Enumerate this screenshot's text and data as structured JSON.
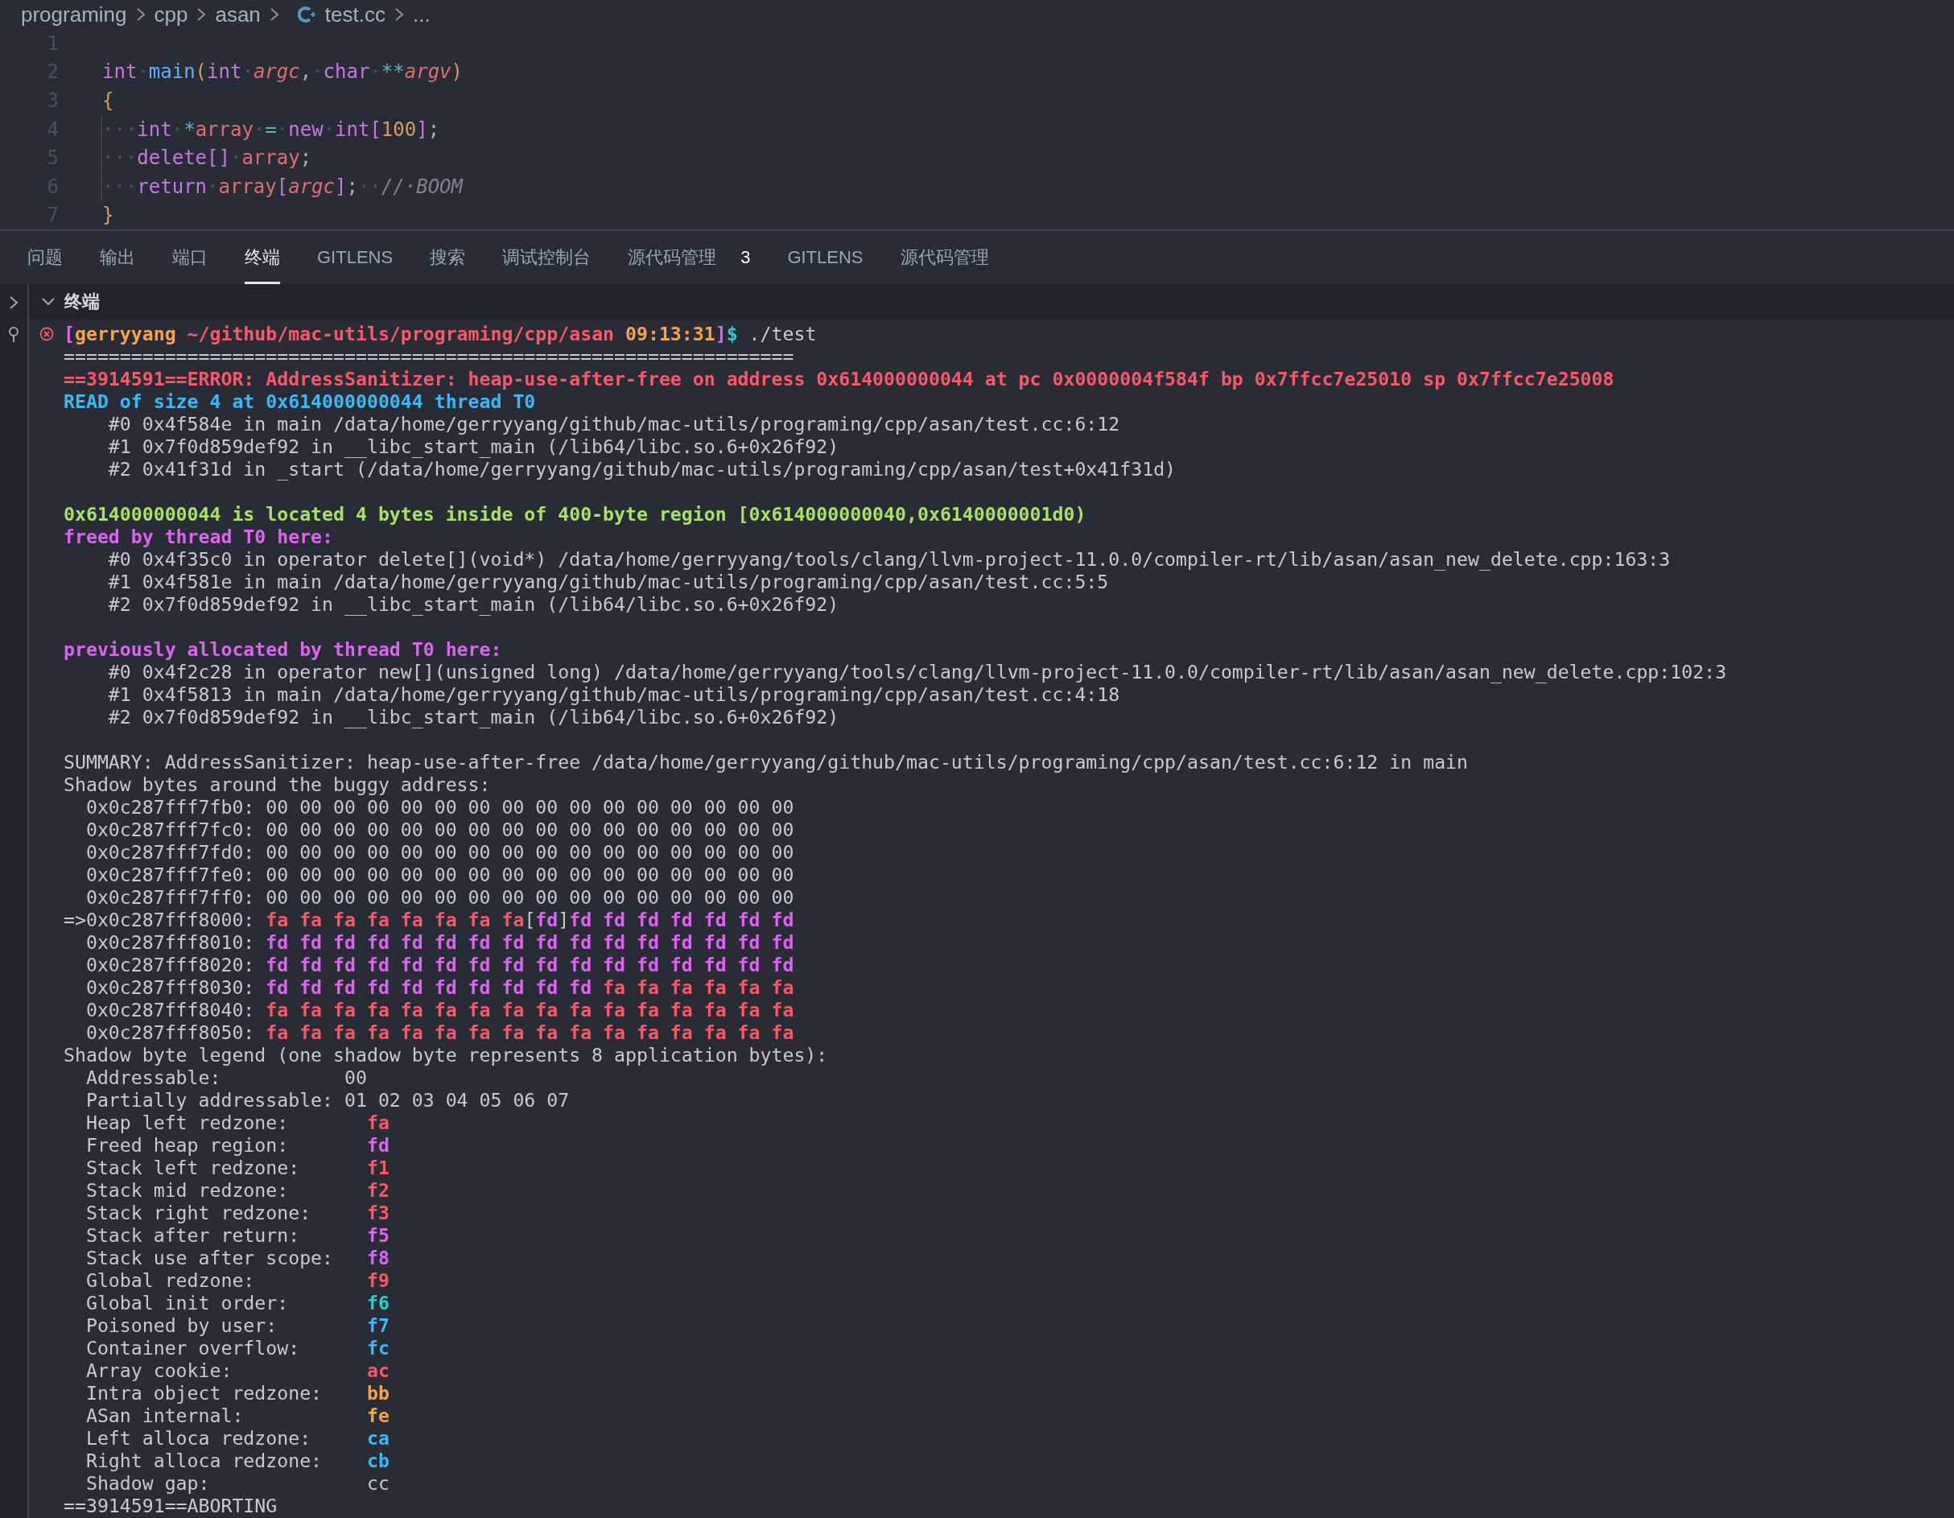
{
  "breadcrumb": [
    {
      "label": "programing",
      "kind": "folder"
    },
    {
      "label": "cpp",
      "kind": "folder"
    },
    {
      "label": "asan",
      "kind": "folder"
    },
    {
      "label": "test.cc",
      "kind": "cpp_file"
    },
    {
      "label": "...",
      "kind": "more"
    }
  ],
  "editor": {
    "lines": [
      {
        "number": "1",
        "indent_guide": false
      },
      {
        "number": "2",
        "indent_guide": false,
        "tokens": [
          {
            "text": "int",
            "kind": "keyword"
          },
          {
            "text": "·",
            "kind": "ws"
          },
          {
            "text": "main",
            "kind": "function"
          },
          {
            "text": "(",
            "kind": "brace"
          },
          {
            "text": "int",
            "kind": "keyword"
          },
          {
            "text": "·",
            "kind": "ws"
          },
          {
            "text": "argc",
            "kind": "param"
          },
          {
            "text": ",",
            "kind": "punct"
          },
          {
            "text": "·",
            "kind": "ws"
          },
          {
            "text": "char",
            "kind": "keyword"
          },
          {
            "text": "·",
            "kind": "ws"
          },
          {
            "text": "**",
            "kind": "operator"
          },
          {
            "text": "argv",
            "kind": "param"
          },
          {
            "text": ")",
            "kind": "brace"
          }
        ]
      },
      {
        "number": "3",
        "indent_guide": false,
        "tokens": [
          {
            "text": "{",
            "kind": "brace"
          }
        ]
      },
      {
        "number": "4",
        "indent_guide": true,
        "tokens": [
          {
            "text": "···",
            "kind": "ws"
          },
          {
            "text": "int",
            "kind": "keyword"
          },
          {
            "text": "·",
            "kind": "ws"
          },
          {
            "text": "*",
            "kind": "operator"
          },
          {
            "text": "array",
            "kind": "variable"
          },
          {
            "text": "·",
            "kind": "ws"
          },
          {
            "text": "=",
            "kind": "operator"
          },
          {
            "text": "·",
            "kind": "ws"
          },
          {
            "text": "new",
            "kind": "keyword"
          },
          {
            "text": "·",
            "kind": "ws"
          },
          {
            "text": "int",
            "kind": "keyword"
          },
          {
            "text": "[",
            "kind": "keyword"
          },
          {
            "text": "100",
            "kind": "number"
          },
          {
            "text": "]",
            "kind": "keyword"
          },
          {
            "text": ";",
            "kind": "punct"
          }
        ]
      },
      {
        "number": "5",
        "indent_guide": true,
        "tokens": [
          {
            "text": "···",
            "kind": "ws"
          },
          {
            "text": "delete[]",
            "kind": "keyword"
          },
          {
            "text": "·",
            "kind": "ws"
          },
          {
            "text": "array",
            "kind": "variable"
          },
          {
            "text": ";",
            "kind": "punct"
          }
        ]
      },
      {
        "number": "6",
        "indent_guide": true,
        "tokens": [
          {
            "text": "···",
            "kind": "ws"
          },
          {
            "text": "return",
            "kind": "keyword"
          },
          {
            "text": "·",
            "kind": "ws"
          },
          {
            "text": "array",
            "kind": "variable"
          },
          {
            "text": "[",
            "kind": "keyword"
          },
          {
            "text": "argc",
            "kind": "param"
          },
          {
            "text": "]",
            "kind": "keyword"
          },
          {
            "text": ";",
            "kind": "punct"
          },
          {
            "text": "··",
            "kind": "ws"
          },
          {
            "text": "//·BOOM",
            "kind": "comment"
          }
        ]
      },
      {
        "number": "7",
        "indent_guide": false,
        "tokens": [
          {
            "text": "}",
            "kind": "brace"
          }
        ]
      }
    ]
  },
  "tabs": [
    {
      "label": "问题",
      "selected": false
    },
    {
      "label": "输出",
      "selected": false
    },
    {
      "label": "端口",
      "selected": false
    },
    {
      "label": "终端",
      "selected": true
    },
    {
      "label": "GITLENS",
      "selected": false
    },
    {
      "label": "搜索",
      "selected": false
    },
    {
      "label": "调试控制台",
      "selected": false
    },
    {
      "label": "源代码管理",
      "selected": false,
      "badge": "3"
    },
    {
      "label": "GITLENS",
      "selected": false
    },
    {
      "label": "源代码管理",
      "selected": false
    }
  ],
  "terminal": {
    "title": "终端",
    "lines": [
      {
        "kind": "command",
        "segments": [
          {
            "text": "[",
            "kind": "magenta"
          },
          {
            "text": "gerryyang",
            "kind": "orange"
          },
          {
            "text": " ~/github/mac-utils/programing/cpp/asan ",
            "kind": "red"
          },
          {
            "text": "09:13:31",
            "kind": "orange"
          },
          {
            "text": "]",
            "kind": "magenta"
          },
          {
            "text": "$",
            "kind": "cyan"
          },
          {
            "text": " ./test",
            "kind": "plain"
          }
        ]
      },
      {
        "kind": "text",
        "segments": [
          {
            "text": "=================================================================",
            "kind": "plain"
          }
        ]
      },
      {
        "kind": "text",
        "segments": [
          {
            "text": "==3914591==ERROR: AddressSanitizer: heap-use-after-free on address 0x614000000044 at pc 0x0000004f584f bp 0x7ffcc7e25010 sp 0x7ffcc7e25008",
            "kind": "red"
          }
        ]
      },
      {
        "kind": "text",
        "segments": [
          {
            "text": "READ of size 4 at 0x614000000044 thread T0",
            "kind": "blue"
          }
        ]
      },
      {
        "kind": "text",
        "segments": [
          {
            "text": "    #0 0x4f584e in main /data/home/gerryyang/github/mac-utils/programing/cpp/asan/test.cc:6:12",
            "kind": "plain"
          }
        ]
      },
      {
        "kind": "text",
        "segments": [
          {
            "text": "    #1 0x7f0d859def92 in __libc_start_main (/lib64/libc.so.6+0x26f92)",
            "kind": "plain"
          }
        ]
      },
      {
        "kind": "text",
        "segments": [
          {
            "text": "    #2 0x41f31d in _start (/data/home/gerryyang/github/mac-utils/programing/cpp/asan/test+0x41f31d)",
            "kind": "plain"
          }
        ]
      },
      {
        "kind": "blank"
      },
      {
        "kind": "text",
        "segments": [
          {
            "text": "0x614000000044 is located 4 bytes inside of 400-byte region [0x614000000040,0x6140000001d0)",
            "kind": "green"
          }
        ]
      },
      {
        "kind": "text",
        "segments": [
          {
            "text": "freed by thread T0 here:",
            "kind": "magenta"
          }
        ]
      },
      {
        "kind": "text",
        "segments": [
          {
            "text": "    #0 0x4f35c0 in operator delete[](void*) /data/home/gerryyang/tools/clang/llvm-project-11.0.0/compiler-rt/lib/asan/asan_new_delete.cpp:163:3",
            "kind": "plain"
          }
        ]
      },
      {
        "kind": "text",
        "segments": [
          {
            "text": "    #1 0x4f581e in main /data/home/gerryyang/github/mac-utils/programing/cpp/asan/test.cc:5:5",
            "kind": "plain"
          }
        ]
      },
      {
        "kind": "text",
        "segments": [
          {
            "text": "    #2 0x7f0d859def92 in __libc_start_main (/lib64/libc.so.6+0x26f92)",
            "kind": "plain"
          }
        ]
      },
      {
        "kind": "blank"
      },
      {
        "kind": "text",
        "segments": [
          {
            "text": "previously allocated by thread T0 here:",
            "kind": "magenta"
          }
        ]
      },
      {
        "kind": "text",
        "segments": [
          {
            "text": "    #0 0x4f2c28 in operator new[](unsigned long) /data/home/gerryyang/tools/clang/llvm-project-11.0.0/compiler-rt/lib/asan/asan_new_delete.cpp:102:3",
            "kind": "plain"
          }
        ]
      },
      {
        "kind": "text",
        "segments": [
          {
            "text": "    #1 0x4f5813 in main /data/home/gerryyang/github/mac-utils/programing/cpp/asan/test.cc:4:18",
            "kind": "plain"
          }
        ]
      },
      {
        "kind": "text",
        "segments": [
          {
            "text": "    #2 0x7f0d859def92 in __libc_start_main (/lib64/libc.so.6+0x26f92)",
            "kind": "plain"
          }
        ]
      },
      {
        "kind": "blank"
      },
      {
        "kind": "text",
        "segments": [
          {
            "text": "SUMMARY: AddressSanitizer: heap-use-after-free /data/home/gerryyang/github/mac-utils/programing/cpp/asan/test.cc:6:12 in main",
            "kind": "plain"
          }
        ]
      },
      {
        "kind": "text",
        "segments": [
          {
            "text": "Shadow bytes around the buggy address:",
            "kind": "plain"
          }
        ]
      },
      {
        "kind": "text",
        "segments": [
          {
            "text": "  0x0c287fff7fb0: 00 00 00 00 00 00 00 00 00 00 00 00 00 00 00 00",
            "kind": "plain"
          }
        ]
      },
      {
        "kind": "text",
        "segments": [
          {
            "text": "  0x0c287fff7fc0: 00 00 00 00 00 00 00 00 00 00 00 00 00 00 00 00",
            "kind": "plain"
          }
        ]
      },
      {
        "kind": "text",
        "segments": [
          {
            "text": "  0x0c287fff7fd0: 00 00 00 00 00 00 00 00 00 00 00 00 00 00 00 00",
            "kind": "plain"
          }
        ]
      },
      {
        "kind": "text",
        "segments": [
          {
            "text": "  0x0c287fff7fe0: 00 00 00 00 00 00 00 00 00 00 00 00 00 00 00 00",
            "kind": "plain"
          }
        ]
      },
      {
        "kind": "text",
        "segments": [
          {
            "text": "  0x0c287fff7ff0: 00 00 00 00 00 00 00 00 00 00 00 00 00 00 00 00",
            "kind": "plain"
          }
        ]
      },
      {
        "kind": "text",
        "segments": [
          {
            "text": "=>0x0c287fff8000: ",
            "kind": "plain"
          },
          {
            "text": "fa fa fa fa fa fa fa fa",
            "kind": "red"
          },
          {
            "text": "[",
            "kind": "plain"
          },
          {
            "text": "fd",
            "kind": "magenta"
          },
          {
            "text": "]",
            "kind": "plain"
          },
          {
            "text": "fd fd fd fd fd fd fd",
            "kind": "magenta"
          }
        ]
      },
      {
        "kind": "text",
        "segments": [
          {
            "text": "  0x0c287fff8010: ",
            "kind": "plain"
          },
          {
            "text": "fd fd fd fd fd fd fd fd fd fd fd fd fd fd fd fd",
            "kind": "magenta"
          }
        ]
      },
      {
        "kind": "text",
        "segments": [
          {
            "text": "  0x0c287fff8020: ",
            "kind": "plain"
          },
          {
            "text": "fd fd fd fd fd fd fd fd fd fd fd fd fd fd fd fd",
            "kind": "magenta"
          }
        ]
      },
      {
        "kind": "text",
        "segments": [
          {
            "text": "  0x0c287fff8030: ",
            "kind": "plain"
          },
          {
            "text": "fd fd fd fd fd fd fd fd fd fd ",
            "kind": "magenta"
          },
          {
            "text": "fa fa fa fa fa fa",
            "kind": "red"
          }
        ]
      },
      {
        "kind": "text",
        "segments": [
          {
            "text": "  0x0c287fff8040: ",
            "kind": "plain"
          },
          {
            "text": "fa fa fa fa fa fa fa fa fa fa fa fa fa fa fa fa",
            "kind": "red"
          }
        ]
      },
      {
        "kind": "text",
        "segments": [
          {
            "text": "  0x0c287fff8050: ",
            "kind": "plain"
          },
          {
            "text": "fa fa fa fa fa fa fa fa fa fa fa fa fa fa fa fa",
            "kind": "red"
          }
        ]
      },
      {
        "kind": "text",
        "segments": [
          {
            "text": "Shadow byte legend (one shadow byte represents 8 application bytes):",
            "kind": "plain"
          }
        ]
      },
      {
        "kind": "text",
        "segments": [
          {
            "text": "  Addressable:           00",
            "kind": "plain"
          }
        ]
      },
      {
        "kind": "text",
        "segments": [
          {
            "text": "  Partially addressable: 01 02 03 04 05 06 07",
            "kind": "plain"
          }
        ]
      },
      {
        "kind": "text",
        "segments": [
          {
            "text": "  Heap left redzone:       ",
            "kind": "plain"
          },
          {
            "text": "fa",
            "kind": "red"
          }
        ]
      },
      {
        "kind": "text",
        "segments": [
          {
            "text": "  Freed heap region:       ",
            "kind": "plain"
          },
          {
            "text": "fd",
            "kind": "magenta"
          }
        ]
      },
      {
        "kind": "text",
        "segments": [
          {
            "text": "  Stack left redzone:      ",
            "kind": "plain"
          },
          {
            "text": "f1",
            "kind": "red"
          }
        ]
      },
      {
        "kind": "text",
        "segments": [
          {
            "text": "  Stack mid redzone:       ",
            "kind": "plain"
          },
          {
            "text": "f2",
            "kind": "red"
          }
        ]
      },
      {
        "kind": "text",
        "segments": [
          {
            "text": "  Stack right redzone:     ",
            "kind": "plain"
          },
          {
            "text": "f3",
            "kind": "red"
          }
        ]
      },
      {
        "kind": "text",
        "segments": [
          {
            "text": "  Stack after return:      ",
            "kind": "plain"
          },
          {
            "text": "f5",
            "kind": "magenta"
          }
        ]
      },
      {
        "kind": "text",
        "segments": [
          {
            "text": "  Stack use after scope:   ",
            "kind": "plain"
          },
          {
            "text": "f8",
            "kind": "magenta"
          }
        ]
      },
      {
        "kind": "text",
        "segments": [
          {
            "text": "  Global redzone:          ",
            "kind": "plain"
          },
          {
            "text": "f9",
            "kind": "red"
          }
        ]
      },
      {
        "kind": "text",
        "segments": [
          {
            "text": "  Global init order:       ",
            "kind": "plain"
          },
          {
            "text": "f6",
            "kind": "cyan"
          }
        ]
      },
      {
        "kind": "text",
        "segments": [
          {
            "text": "  Poisoned by user:        ",
            "kind": "plain"
          },
          {
            "text": "f7",
            "kind": "blue"
          }
        ]
      },
      {
        "kind": "text",
        "segments": [
          {
            "text": "  Container overflow:      ",
            "kind": "plain"
          },
          {
            "text": "fc",
            "kind": "blue"
          }
        ]
      },
      {
        "kind": "text",
        "segments": [
          {
            "text": "  Array cookie:            ",
            "kind": "plain"
          },
          {
            "text": "ac",
            "kind": "red"
          }
        ]
      },
      {
        "kind": "text",
        "segments": [
          {
            "text": "  Intra object redzone:    ",
            "kind": "plain"
          },
          {
            "text": "bb",
            "kind": "orange"
          }
        ]
      },
      {
        "kind": "text",
        "segments": [
          {
            "text": "  ASan internal:           ",
            "kind": "plain"
          },
          {
            "text": "fe",
            "kind": "orange"
          }
        ]
      },
      {
        "kind": "text",
        "segments": [
          {
            "text": "  Left alloca redzone:     ",
            "kind": "plain"
          },
          {
            "text": "ca",
            "kind": "blue"
          }
        ]
      },
      {
        "kind": "text",
        "segments": [
          {
            "text": "  Right alloca redzone:    ",
            "kind": "plain"
          },
          {
            "text": "cb",
            "kind": "blue"
          }
        ]
      },
      {
        "kind": "text",
        "segments": [
          {
            "text": "  Shadow gap:              cc",
            "kind": "plain"
          }
        ]
      },
      {
        "kind": "text",
        "segments": [
          {
            "text": "==3914591==ABORTING",
            "kind": "plain"
          }
        ]
      }
    ]
  }
}
